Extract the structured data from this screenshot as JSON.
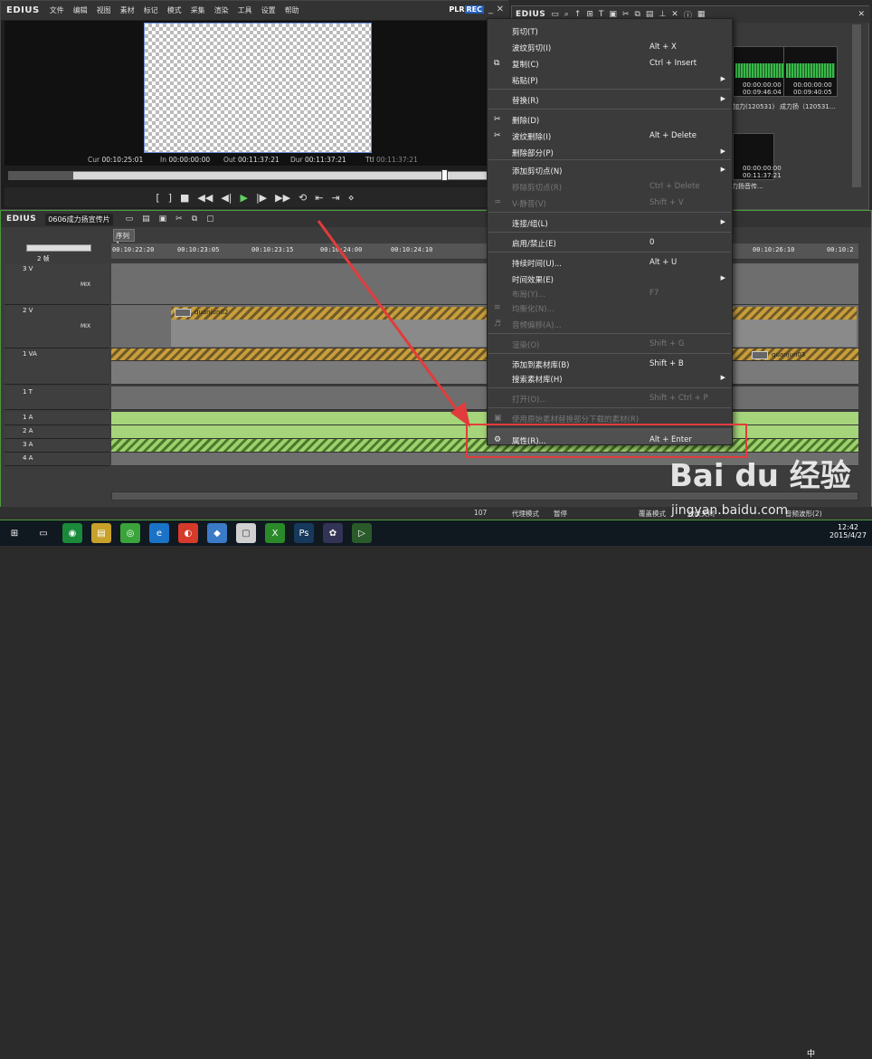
{
  "player": {
    "brand": "EDIUS",
    "menus": [
      "文件",
      "编辑",
      "视图",
      "素材",
      "标记",
      "模式",
      "采集",
      "渲染",
      "工具",
      "设置",
      "帮助"
    ],
    "plr": "PLR",
    "rec": "REC",
    "cur_label": "Cur",
    "cur": "00:10:25:01",
    "in_label": "In",
    "in": "00:00:00:00",
    "out_label": "Out",
    "out": "00:11:37:21",
    "dur_label": "Dur",
    "dur": "00:11:37:21",
    "ttl_label": "Ttl",
    "ttl": "00:11:37:21",
    "scrub_position": 0.88
  },
  "bin": {
    "brand": "EDIUS",
    "clips": [
      {
        "tc1": "00:00:00:00",
        "tc2": "00:09:46:04",
        "caption": "加力(120531)"
      },
      {
        "tc1": "00:00:00:00",
        "tc2": "00:09:40:05",
        "caption": "成力扬（120531..."
      },
      {
        "tc1": "00:00:00:00",
        "tc2": "00:11:37:21",
        "caption": "成力扬音传..."
      }
    ]
  },
  "timeline": {
    "brand": "EDIUS",
    "project_name": "0606成力扬宣传片",
    "sequence_tab": "序列1",
    "zoom_label": "2 帧",
    "ruler_ticks": [
      "00:10:22:20",
      "00:10:23:05",
      "00:10:23:15",
      "00:10:24:00",
      "00:10:24:10",
      "00:10:26:10",
      "00:10:2"
    ],
    "tracks": [
      {
        "name": "3 V",
        "type": "V"
      },
      {
        "name": "2 V",
        "type": "V"
      },
      {
        "name": "1 VA",
        "type": "VA"
      },
      {
        "name": "1 T",
        "type": "T"
      },
      {
        "name": "1 A",
        "type": "A"
      },
      {
        "name": "2 A",
        "type": "A"
      },
      {
        "name": "3 A",
        "type": "A"
      },
      {
        "name": "4 A",
        "type": "A"
      }
    ],
    "clip_2v": "quanjun02",
    "clip_1va": "quanjun03",
    "mix_label": "MIX"
  },
  "context_menu": {
    "items": [
      {
        "label": "剪切(T)",
        "shortcut": "",
        "disabled": false
      },
      {
        "label": "波纹剪切(I)",
        "shortcut": "Alt + X",
        "disabled": false
      },
      {
        "label": "复制(C)",
        "shortcut": "Ctrl + Insert",
        "disabled": false
      },
      {
        "label": "粘贴(P)",
        "shortcut": "",
        "disabled": false,
        "submenu": true
      },
      {
        "label": "替换(R)",
        "shortcut": "",
        "disabled": false,
        "submenu": true
      },
      {
        "label": "删除(D)",
        "shortcut": "",
        "disabled": false
      },
      {
        "label": "波纹删除(I)",
        "shortcut": "Alt + Delete",
        "disabled": false
      },
      {
        "label": "删除部分(P)",
        "shortcut": "",
        "disabled": false,
        "submenu": true
      },
      {
        "label": "添加剪切点(N)",
        "shortcut": "",
        "disabled": false,
        "submenu": true
      },
      {
        "label": "移除剪切点(R)",
        "shortcut": "Ctrl + Delete",
        "disabled": true
      },
      {
        "label": "V-静音(V)",
        "shortcut": "Shift + V",
        "disabled": true
      },
      {
        "label": "连接/组(L)",
        "shortcut": "",
        "disabled": false,
        "submenu": true
      },
      {
        "label": "启用/禁止(E)",
        "shortcut": "0",
        "disabled": false
      },
      {
        "label": "持续时间(U)...",
        "shortcut": "Alt + U",
        "disabled": false
      },
      {
        "label": "时间效果(E)",
        "shortcut": "",
        "disabled": false,
        "submenu": true
      },
      {
        "label": "布局(Y)...",
        "shortcut": "F7",
        "disabled": true
      },
      {
        "label": "均衡化(N)...",
        "shortcut": "",
        "disabled": true
      },
      {
        "label": "音频偏移(A)...",
        "shortcut": "",
        "disabled": true
      },
      {
        "label": "渲染(O)",
        "shortcut": "Shift + G",
        "disabled": true
      },
      {
        "label": "添加到素材库(B)",
        "shortcut": "Shift + B",
        "disabled": false
      },
      {
        "label": "搜索素材库(H)",
        "shortcut": "",
        "disabled": false,
        "submenu": true
      },
      {
        "label": "打开(O)...",
        "shortcut": "Shift + Ctrl + P",
        "disabled": true
      },
      {
        "label": "使用原始素材替换部分下载的素材(R)",
        "shortcut": "",
        "disabled": true
      },
      {
        "label": "属性(R)...",
        "shortcut": "Alt + Enter",
        "disabled": false
      }
    ]
  },
  "status_bar": {
    "frame": "107",
    "proxy_mode": "代理模式",
    "pause": "暂停",
    "overwrite": "覆盖模式",
    "ripple": "波纹关闭",
    "audio": "音频波形(2)"
  },
  "taskbar": {
    "time": "12:42",
    "date": "2015/4/27",
    "ime": "中"
  },
  "watermark": {
    "logo": "Bai du 经验",
    "url": "jingyan.baidu.com"
  },
  "colors": {
    "highlight_box": "#e23b3b",
    "arrow": "#e23b3b",
    "rec_badge": "#1f5fbf",
    "timeline_border": "#4a9a3a"
  }
}
